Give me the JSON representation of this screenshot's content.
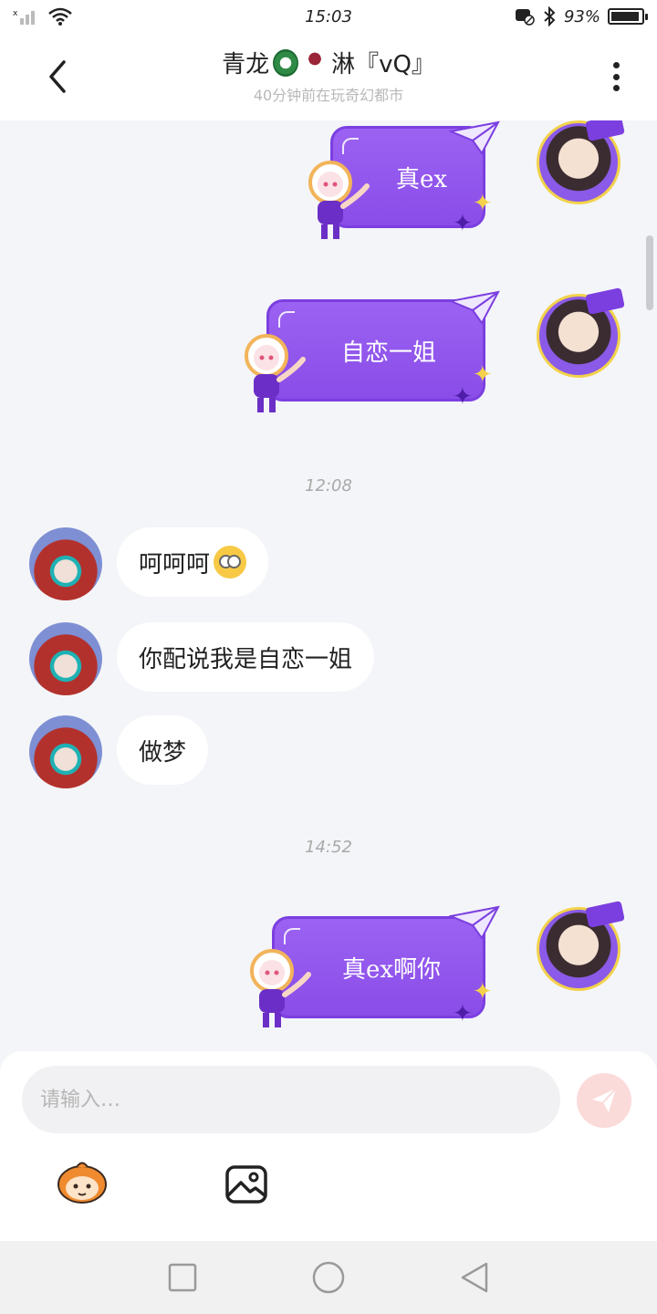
{
  "status_bar": {
    "time": "15:03",
    "battery": "93%",
    "battery_level": 0.93
  },
  "header": {
    "name_part1": "青龙",
    "name_part2": "淋『vQ』",
    "subtitle": "40分钟前在玩奇幻都市",
    "icons": [
      "back-icon",
      "more-icon"
    ]
  },
  "messages": {
    "out1": "真ex",
    "out2": "自恋一姐",
    "time1": "12:08",
    "in1": "呵呵呵",
    "in2": "你配说我是自恋一姐",
    "in3": "做梦",
    "time2": "14:52",
    "out3": "真ex啊你"
  },
  "composer": {
    "placeholder": "请输入…",
    "icons": [
      "send-icon",
      "sticker-icon",
      "image-icon"
    ]
  },
  "colors": {
    "bubble_out": "#8a4de8",
    "bubble_in": "#ffffff",
    "background": "#f4f5f8",
    "send_button": "#fbdada"
  }
}
